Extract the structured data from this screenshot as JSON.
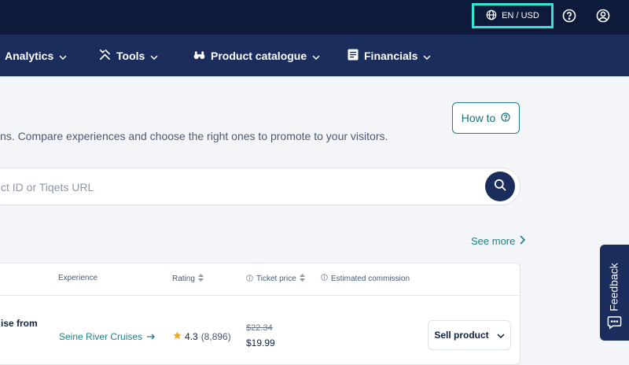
{
  "topbar": {
    "locale_label": "EN / USD",
    "icons": [
      "globe-icon",
      "help-icon",
      "account-icon"
    ]
  },
  "nav": {
    "items": [
      {
        "label": "Analytics",
        "icon": "chevron-down-icon"
      },
      {
        "label": "Tools",
        "icon": "tools-icon"
      },
      {
        "label": "Product catalogue",
        "icon": "binoculars-icon"
      },
      {
        "label": "Financials",
        "icon": "document-icon"
      }
    ]
  },
  "page": {
    "howto_label": "How to",
    "description": "ns. Compare experiences and choose the right ones to promote to your visitors.",
    "search_placeholder": "ct ID or Tiqets URL",
    "see_more_label": "See more"
  },
  "table": {
    "headers": {
      "experience": "Experience",
      "rating": "Rating",
      "ticket_price": "Ticket price",
      "commission": "Estimated commission"
    },
    "rows": [
      {
        "product": "ise from",
        "experience": "Seine River Cruises",
        "rating": "4.3",
        "rating_count": "(8,896)",
        "old_price": "$22.34",
        "price": "$19.99",
        "action": "Sell product"
      }
    ]
  },
  "feedback": {
    "label": "Feedback"
  },
  "colors": {
    "topbar_bg": "#0d1a3a",
    "navbar_bg": "#1b2d5c",
    "accent_teal": "#1e7f86",
    "highlight": "#2ee8d6",
    "star": "#f5a623"
  }
}
